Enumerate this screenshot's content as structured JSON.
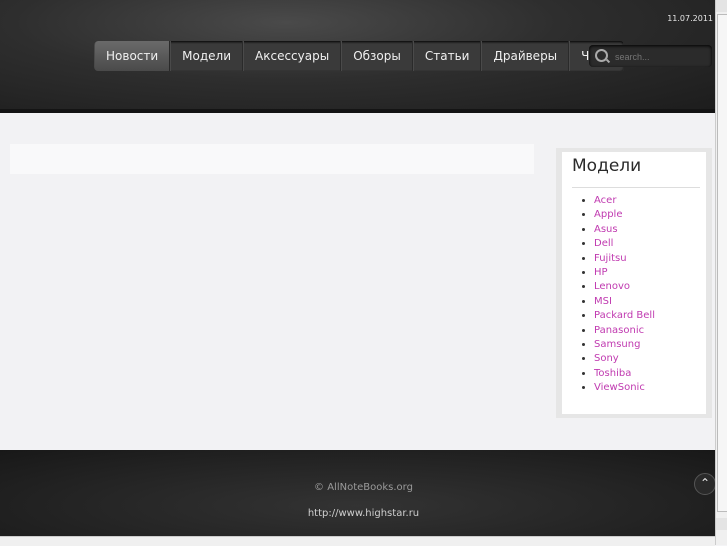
{
  "header": {
    "date": "11.07.2011"
  },
  "nav": {
    "items": [
      "Новости",
      "Модели",
      "Аксессуары",
      "Обзоры",
      "Статьи",
      "Драйверы",
      "ЧаВо"
    ]
  },
  "search": {
    "placeholder": "search..."
  },
  "sidebar": {
    "title": "Модели",
    "items": [
      "Acer",
      "Apple",
      "Asus",
      "Dell",
      "Fujitsu",
      "HP",
      "Lenovo",
      "MSI",
      "Packard Bell",
      "Panasonic",
      "Samsung",
      "Sony",
      "Toshiba",
      "ViewSonic"
    ]
  },
  "footer": {
    "copyright": "© AllNoteBooks.org",
    "link": "http://www.highstar.ru"
  },
  "totop": {
    "glyph": "⌃"
  },
  "colors": {
    "link": "#c03ab0"
  }
}
